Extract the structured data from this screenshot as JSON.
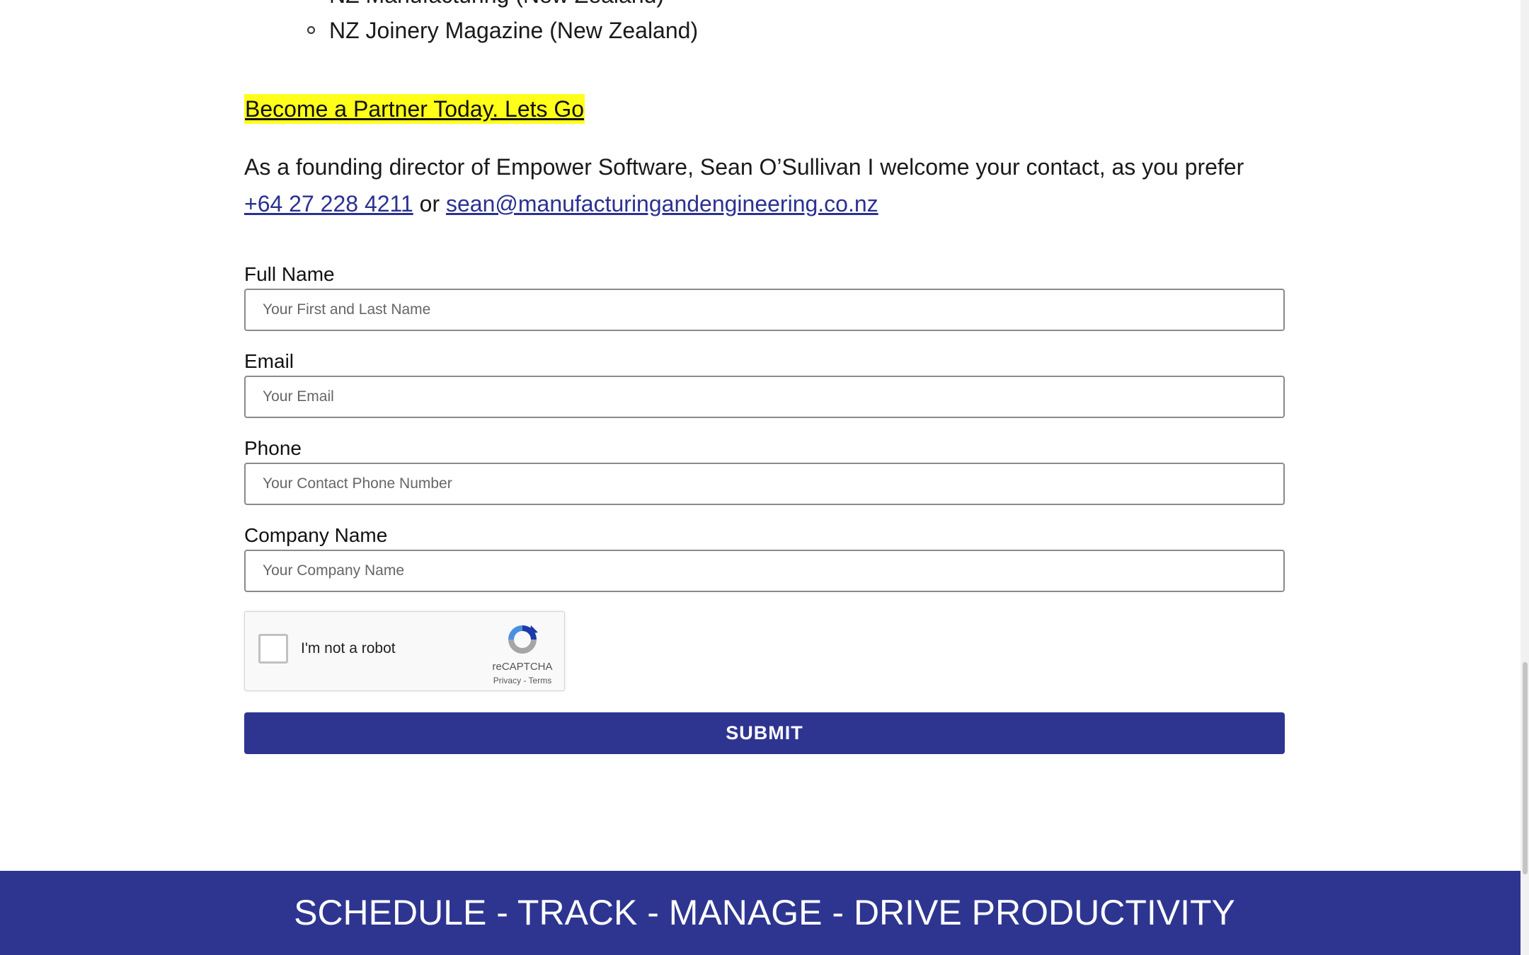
{
  "outlets_list": {
    "items": [
      "NZ Manufacturing (New Zealand)",
      "NZ Joinery Magazine (New Zealand)"
    ]
  },
  "partner_cta": "Become a Partner Today.  Lets Go",
  "intro": {
    "text": "As a founding director of Empower Software, Sean O’Sullivan I welcome your contact, as you prefer",
    "phone": "+64 27 228 4211",
    "joiner": "or",
    "email": "sean@manufacturingandengineering.co.nz"
  },
  "form": {
    "full_name": {
      "label": "Full Name",
      "placeholder": "Your First and Last Name",
      "value": ""
    },
    "email": {
      "label": "Email",
      "placeholder": "Your Email",
      "value": ""
    },
    "phone": {
      "label": "Phone",
      "placeholder": "Your Contact Phone Number",
      "value": ""
    },
    "company": {
      "label": "Company Name",
      "placeholder": "Your Company Name",
      "value": ""
    },
    "submit_label": "SUBMIT"
  },
  "recaptcha": {
    "label": "I'm not a robot",
    "brand": "reCAPTCHA",
    "terms": "Privacy - Terms",
    "checked": false
  },
  "footer": {
    "tagline": "SCHEDULE - TRACK - MANAGE - DRIVE PRODUCTIVITY"
  },
  "colors": {
    "brand_blue": "#2e3590",
    "highlight_yellow": "#ffff1a",
    "link_blue": "#2b3191"
  },
  "icons": {
    "list_bullet": "hollow-circle-bullet-icon",
    "recaptcha_logo": "recaptcha-logo-icon"
  }
}
